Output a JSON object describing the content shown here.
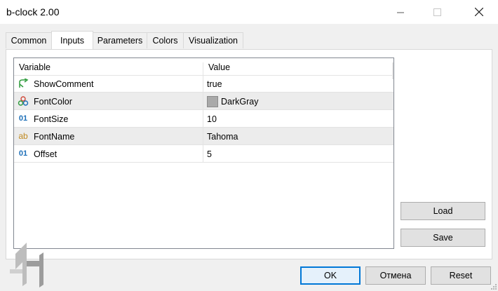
{
  "window": {
    "title": "b-clock 2.00"
  },
  "tabs": [
    {
      "label": "Common"
    },
    {
      "label": "Inputs"
    },
    {
      "label": "Parameters"
    },
    {
      "label": "Colors"
    },
    {
      "label": "Visualization"
    }
  ],
  "grid": {
    "headers": {
      "variable": "Variable",
      "value": "Value"
    },
    "rows": [
      {
        "icon": "bool-arrow-icon",
        "name": "ShowComment",
        "value": "true"
      },
      {
        "icon": "color-palette-icon",
        "name": "FontColor",
        "value": "DarkGray",
        "color": "#a9a9a9"
      },
      {
        "icon": "integer-icon",
        "name": "FontSize",
        "value": "10"
      },
      {
        "icon": "string-icon",
        "name": "FontName",
        "value": "Tahoma"
      },
      {
        "icon": "integer-icon",
        "name": "Offset",
        "value": "5"
      }
    ]
  },
  "side_buttons": {
    "load": "Load",
    "save": "Save"
  },
  "footer": {
    "ok": "OK",
    "cancel": "Отмена",
    "reset": "Reset"
  },
  "colors": {
    "accent": "#0078d7",
    "bool_icon": "#2e9b3c",
    "int_icon": "#1d6fb8",
    "str_icon": "#c08a22"
  }
}
